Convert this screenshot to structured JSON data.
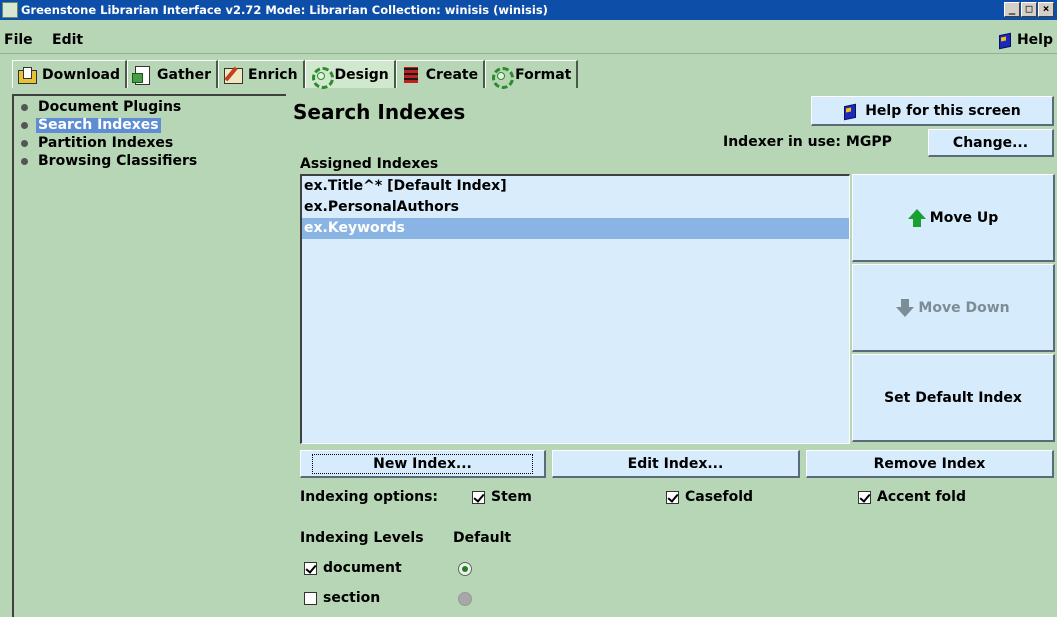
{
  "window": {
    "title": "Greenstone Librarian Interface v2.72  Mode: Librarian  Collection: winisis (winisis)",
    "min_label": "_",
    "max_label": "□",
    "close_label": "×"
  },
  "menubar": {
    "file": "File",
    "edit": "Edit",
    "help": "Help"
  },
  "tabs": [
    {
      "label": "Download",
      "icon": "download-icon"
    },
    {
      "label": "Gather",
      "icon": "gather-icon"
    },
    {
      "label": "Enrich",
      "icon": "enrich-icon"
    },
    {
      "label": "Design",
      "icon": "gear-icon",
      "selected": true
    },
    {
      "label": "Create",
      "icon": "create-icon"
    },
    {
      "label": "Format",
      "icon": "gear-icon"
    }
  ],
  "tree": {
    "items": [
      {
        "label": "Document Plugins"
      },
      {
        "label": "Search Indexes",
        "selected": true
      },
      {
        "label": "Partition Indexes"
      },
      {
        "label": "Browsing Classifiers"
      }
    ]
  },
  "main": {
    "title": "Search Indexes",
    "help_button": "Help for this screen",
    "indexer_label": "Indexer in use: MGPP",
    "change_button": "Change...",
    "assigned_label": "Assigned Indexes",
    "indexes": [
      {
        "label": "ex.Title^* [Default Index]"
      },
      {
        "label": "ex.PersonalAuthors"
      },
      {
        "label": "ex.Keywords",
        "selected": true
      }
    ],
    "move_up": "Move Up",
    "move_down": "Move Down",
    "set_default": "Set Default Index",
    "new_index": "New Index...",
    "edit_index": "Edit Index...",
    "remove_index": "Remove Index",
    "indexing_options_label": "Indexing options:",
    "options": [
      {
        "label": "Stem",
        "checked": true
      },
      {
        "label": "Casefold",
        "checked": true
      },
      {
        "label": "Accent fold",
        "checked": true
      }
    ],
    "levels_label": "Indexing Levels",
    "default_label": "Default",
    "levels": [
      {
        "label": "document",
        "checked": true,
        "default": true
      },
      {
        "label": "section",
        "checked": false,
        "default": false
      }
    ]
  },
  "colors": {
    "panel_bg": "#b7d6b5",
    "button_bg": "#d6ebfb",
    "selection": "#8ab4e3",
    "titlebar": "#0d4ea8"
  }
}
